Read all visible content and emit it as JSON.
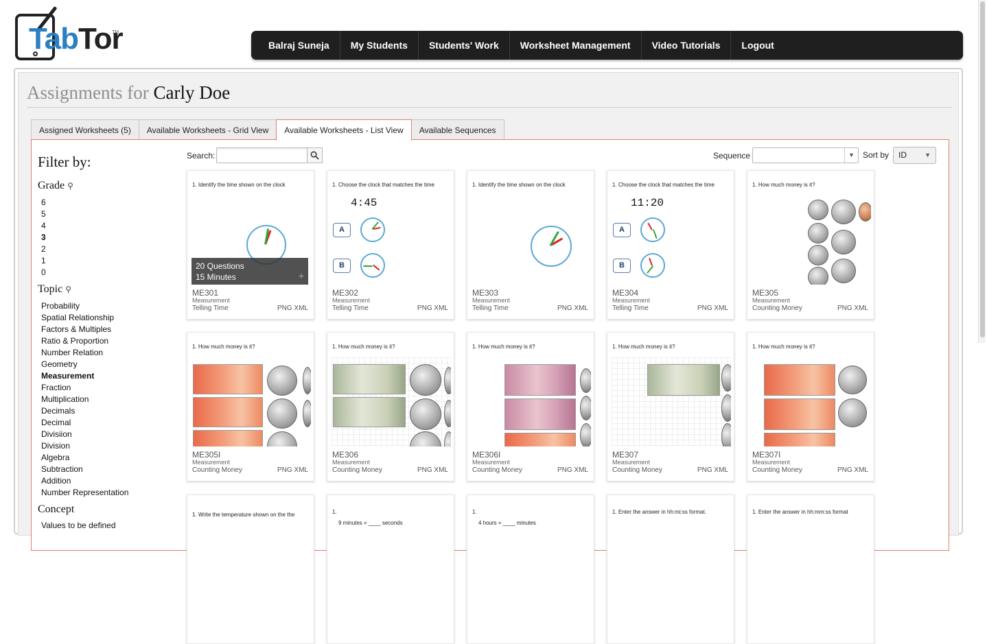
{
  "logo": {
    "part1": "Tab",
    "part2": "Tor",
    "tm": "TM"
  },
  "nav": [
    "Balraj Suneja",
    "My Students",
    "Students' Work",
    "Worksheet Management",
    "Video Tutorials",
    "Logout"
  ],
  "page": {
    "title_prefix": "Assignments for ",
    "student": "Carly Doe"
  },
  "tabs": [
    "Assigned Worksheets (5)",
    "Available Worksheets - Grid View",
    "Available Worksheets - List View",
    "Available Sequences"
  ],
  "active_tab": 2,
  "filter": {
    "title": "Filter by:",
    "grade_label": "Grade",
    "grades": [
      "6",
      "5",
      "4",
      "3",
      "2",
      "1",
      "0"
    ],
    "selected_grade": "3",
    "topic_label": "Topic",
    "topics": [
      "Probability",
      "Spatial Relationship",
      "Factors & Multiples",
      "Ratio & Proportion",
      "Number Relation",
      "Geometry",
      "Measurement",
      "Fraction",
      "Multiplication",
      "Decimals",
      "Decimal",
      "Divisiion",
      "Division",
      "Algebra",
      "Subtraction",
      "Addition",
      "Number Representation"
    ],
    "selected_topic": "Measurement",
    "concept_label": "Concept",
    "concepts": [
      "Values to be defined"
    ]
  },
  "toolbar": {
    "search_label": "Search:",
    "search_value": "",
    "sequence_label": "Sequence",
    "sequence_value": "",
    "sort_label": "Sort by",
    "sort_value": "ID"
  },
  "overlay": {
    "questions": "20 Questions",
    "minutes": "15 Minutes",
    "plus": "+"
  },
  "worksheets": [
    {
      "code": "ME301",
      "category": "Measurement",
      "subtopic": "Telling Time",
      "formats": "PNG XML",
      "question": "1. Identify the time shown on the clock"
    },
    {
      "code": "ME302",
      "category": "Measurement",
      "subtopic": "Telling Time",
      "formats": "PNG XML",
      "question": "1. Choose the clock that matches the time",
      "time": "4:45",
      "opt_a": "A",
      "opt_b": "B"
    },
    {
      "code": "ME303",
      "category": "Measurement",
      "subtopic": "Telling Time",
      "formats": "PNG XML",
      "question": "1. Identify the time shown on the clock"
    },
    {
      "code": "ME304",
      "category": "Measurement",
      "subtopic": "Telling Time",
      "formats": "PNG XML",
      "question": "1. Choose the clock that matches the time",
      "time": "11:20",
      "opt_a": "A",
      "opt_b": "B"
    },
    {
      "code": "ME305",
      "category": "Measurement",
      "subtopic": "Counting Money",
      "formats": "PNG XML",
      "question": "1. How much money is it?"
    },
    {
      "code": "ME305I",
      "category": "Measurement",
      "subtopic": "Counting Money",
      "formats": "PNG XML",
      "question": "1. How much money is it?"
    },
    {
      "code": "ME306",
      "category": "Measurement",
      "subtopic": "Counting Money",
      "formats": "PNG XML",
      "question": "1. How much money is it?"
    },
    {
      "code": "ME306I",
      "category": "Measurement",
      "subtopic": "Counting Money",
      "formats": "PNG XML",
      "question": "1. How much money is it?"
    },
    {
      "code": "ME307",
      "category": "Measurement",
      "subtopic": "Counting Money",
      "formats": "PNG XML",
      "question": "1. How much money is it?"
    },
    {
      "code": "ME307I",
      "category": "Measurement",
      "subtopic": "Counting Money",
      "formats": "PNG XML",
      "question": "1. How much money is it?"
    },
    {
      "question": "1. Write the temperature shown on the the"
    },
    {
      "question": "1.",
      "line2": "9 minutes = ____ seconds"
    },
    {
      "question": "1.",
      "line2": "4 hours = ____ minutes"
    },
    {
      "question": "1. Enter the answer in hh:mi:ss format."
    },
    {
      "question": "1. Enter the answer in hh:mm:ss format"
    }
  ],
  "colors": {
    "nav_bg": "#1f1f1f",
    "tab_accent": "#d9826b",
    "clock_rim": "#5aa7d8",
    "logo_blue": "#2b7fc3"
  }
}
